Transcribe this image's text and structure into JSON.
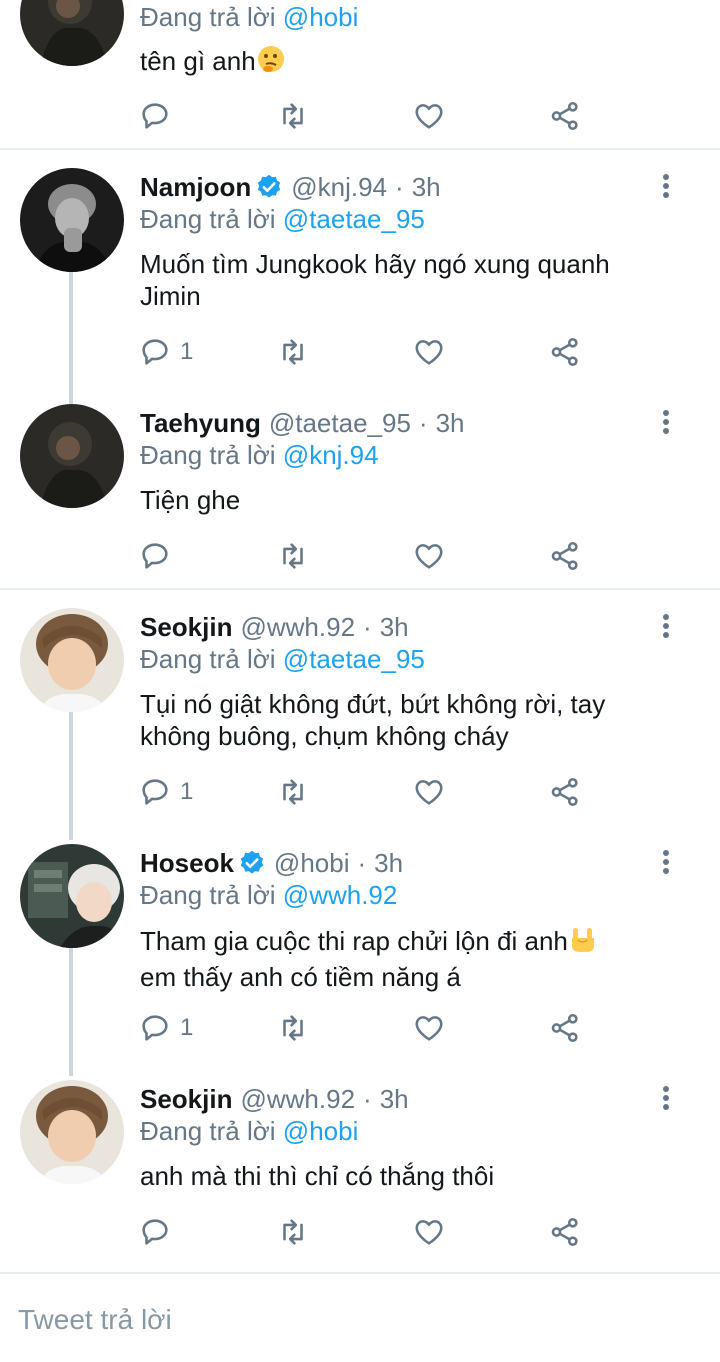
{
  "tweets": [
    {
      "id": "t0",
      "replying_prefix": "Đang trả lời",
      "replying_to": "@hobi",
      "text": "tên gì anh",
      "emoji": "thinking-face",
      "reply_count": ""
    },
    {
      "id": "t1",
      "name": "Namjoon",
      "verified": true,
      "handle": "@knj.94",
      "time": "3h",
      "replying_prefix": "Đang trả lời",
      "replying_to": "@taetae_95",
      "text": "Muốn tìm Jungkook hãy ngó xung quanh Jimin",
      "reply_count": "1"
    },
    {
      "id": "t2",
      "name": "Taehyung",
      "verified": false,
      "handle": "@taetae_95",
      "time": "3h",
      "replying_prefix": "Đang trả lời",
      "replying_to": "@knj.94",
      "text": "Tiện ghe",
      "reply_count": ""
    },
    {
      "id": "t3",
      "name": "Seokjin",
      "verified": false,
      "handle": "@wwh.92",
      "time": "3h",
      "replying_prefix": "Đang trả lời",
      "replying_to": "@taetae_95",
      "text": "Tụi nó giật không đứt, bứt không rời, tay không buông, chụm không cháy",
      "reply_count": "1"
    },
    {
      "id": "t4",
      "name": "Hoseok",
      "verified": true,
      "handle": "@hobi",
      "time": "3h",
      "replying_prefix": "Đang trả lời",
      "replying_to": "@wwh.92",
      "text": "Tham gia cuộc thi rap chửi lộn đi anh",
      "text2": "em thấy anh có tiềm năng á",
      "emoji": "sign-of-the-horns",
      "reply_count": "1"
    },
    {
      "id": "t5",
      "name": "Seokjin",
      "verified": false,
      "handle": "@wwh.92",
      "time": "3h",
      "replying_prefix": "Đang trả lời",
      "replying_to": "@hobi",
      "text": "anh mà thi thì chỉ có thắng thôi",
      "reply_count": ""
    }
  ],
  "separator": "·",
  "composer": {
    "placeholder": "Tweet trả lời"
  },
  "icons": [
    "reply-icon",
    "retweet-icon",
    "like-icon",
    "share-icon",
    "more-icon",
    "verified-icon"
  ],
  "colors": {
    "accent": "#1da1f2",
    "muted": "#657786",
    "divider": "#e6ecf0",
    "thread": "#ccd6dd"
  }
}
